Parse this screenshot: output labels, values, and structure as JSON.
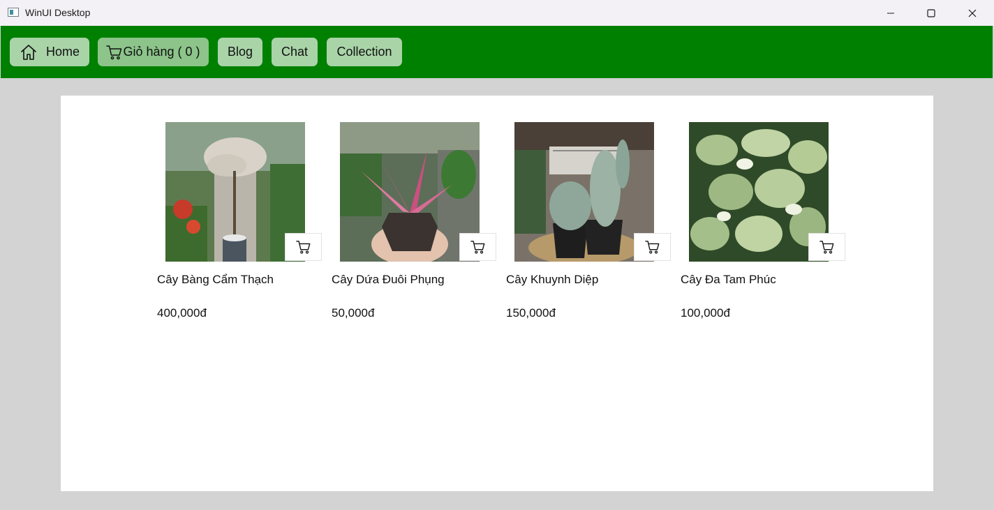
{
  "window": {
    "title": "WinUI Desktop",
    "app_icon": "app-window-icon",
    "minimize_icon": "minimize-icon",
    "maximize_icon": "maximize-icon",
    "close_icon": "close-icon"
  },
  "nav": {
    "background": "#008000",
    "button_color": "#a9d4a8",
    "active_button_color": "#8cc48a",
    "home": {
      "label": "Home",
      "icon": "home-icon"
    },
    "cart": {
      "label": "Giỏ hàng ( 0 )",
      "icon": "cart-icon"
    },
    "blog": {
      "label": "Blog"
    },
    "chat": {
      "label": "Chat"
    },
    "collection": {
      "label": "Collection"
    }
  },
  "products": [
    {
      "name": "Cây Bàng Cẩm Thạch",
      "price": "400,000đ",
      "cart_icon": "add-to-cart-icon"
    },
    {
      "name": "Cây Dứa Đuôi Phụng",
      "price": "50,000đ",
      "cart_icon": "add-to-cart-icon"
    },
    {
      "name": "Cây Khuynh Diệp",
      "price": "150,000đ",
      "cart_icon": "add-to-cart-icon"
    },
    {
      "name": "Cây Đa Tam Phúc",
      "price": "100,000đ",
      "cart_icon": "add-to-cart-icon"
    }
  ]
}
